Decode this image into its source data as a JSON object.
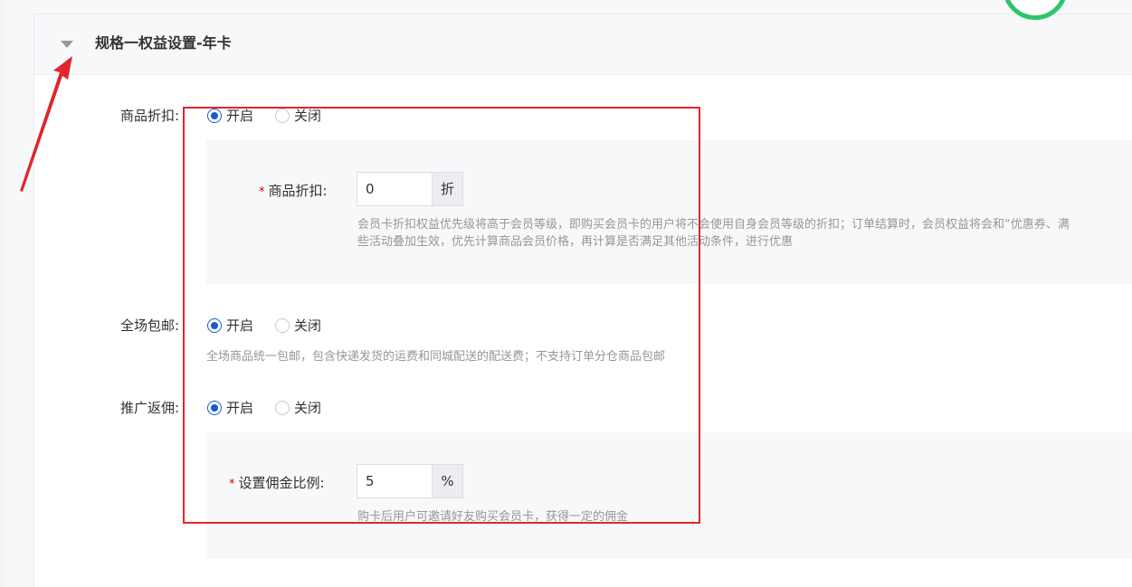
{
  "panel": {
    "title": "规格一权益设置-年卡"
  },
  "discount": {
    "label": "商品折扣:",
    "options": [
      "开启",
      "关闭"
    ],
    "selected": "开启",
    "input_label": "商品折扣:",
    "input_value": "0",
    "input_suffix": "折",
    "help_line1": "会员卡折扣权益优先级将高于会员等级，即购买会员卡的用户将不会使用自身会员等级的折扣；订单结算时，会员权益将会和“优惠券、满",
    "help_line2": "些活动叠加生效，优先计算商品会员价格，再计算是否满足其他活动条件，进行优惠"
  },
  "shipping": {
    "label": "全场包邮:",
    "options": [
      "开启",
      "关闭"
    ],
    "selected": "开启",
    "help": "全场商品统一包邮，包含快递发货的运费和同城配送的配送费；不支持订单分仓商品包邮"
  },
  "commission": {
    "label": "推广返佣:",
    "options": [
      "开启",
      "关闭"
    ],
    "selected": "开启",
    "input_label": "设置佣金比例:",
    "input_value": "5",
    "input_suffix": "%",
    "help": "购卡后用户可邀请好友购买会员卡，获得一定的佣金"
  },
  "colors": {
    "accent": "#155bd4",
    "annotation": "#e0262b",
    "required_star": "#d40000"
  }
}
